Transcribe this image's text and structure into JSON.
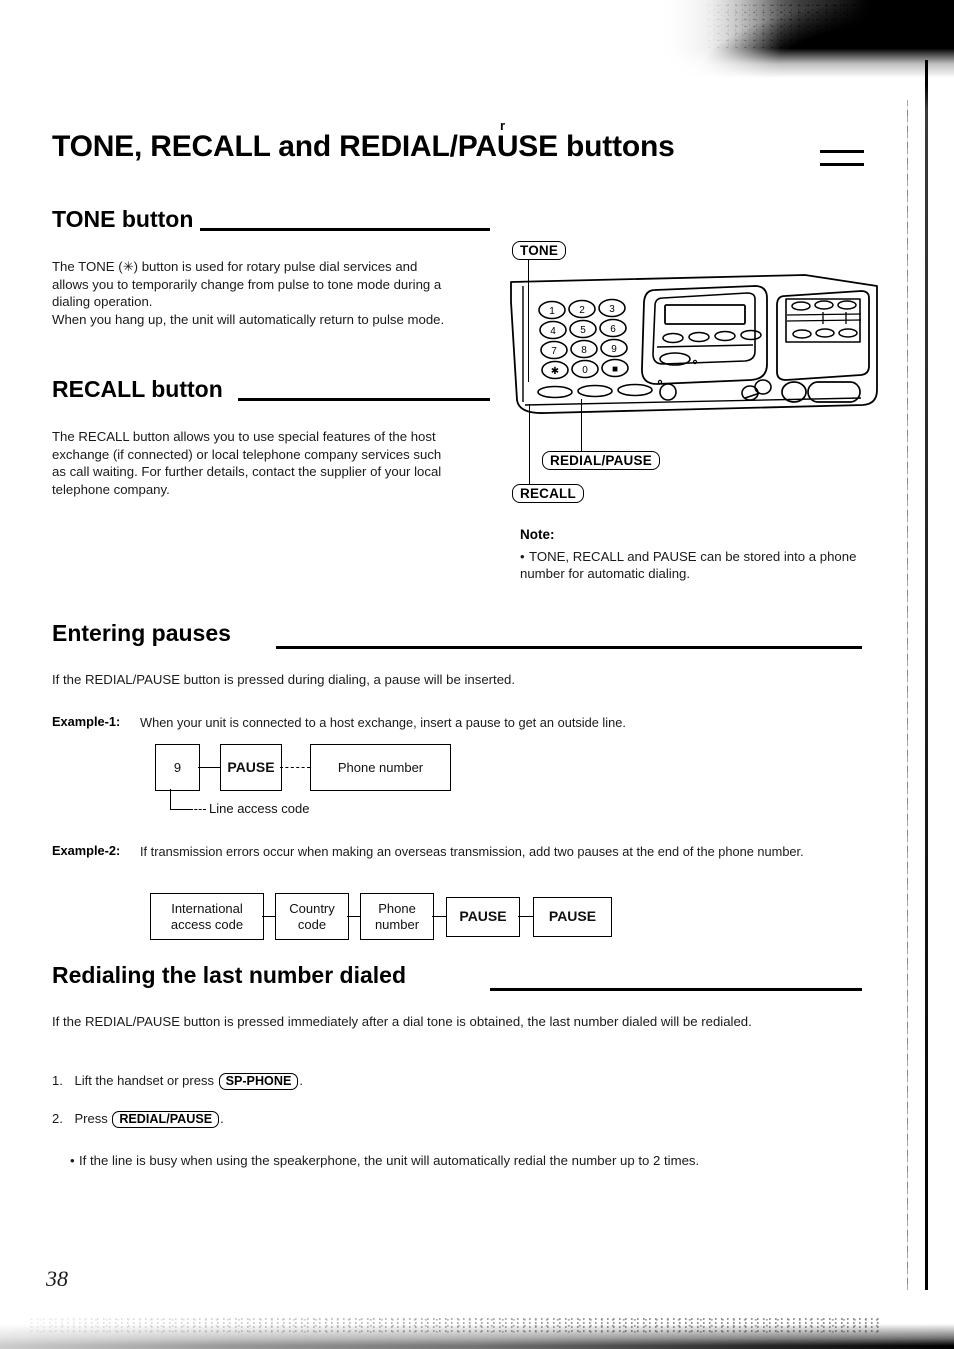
{
  "page": {
    "number": "38",
    "title": "TONE, RECALL and REDIAL/PAUSE buttons",
    "stray_mark": "r"
  },
  "sections": {
    "tone": {
      "heading": "TONE button",
      "body": "The TONE (✳) button is used for rotary pulse dial services and allows you to temporarily change from pulse to tone mode during a dialing operation.\nWhen you hang up, the unit will automatically return to pulse mode."
    },
    "recall": {
      "heading": "RECALL button",
      "body": "The RECALL button allows you to use special features of the host exchange (if connected) or local telephone company services such as call waiting. For further details, contact the supplier of your local telephone company."
    },
    "entering_pauses": {
      "heading": "Entering pauses",
      "intro": "If the REDIAL/PAUSE button is pressed during dialing, a pause will be inserted.",
      "example1": {
        "label": "Example-1:",
        "text": "When your unit is connected to a host exchange, insert a pause to get an outside line.",
        "flow": [
          "9",
          "PAUSE",
          "Phone number"
        ],
        "leader_label": "Line access code"
      },
      "example2": {
        "label": "Example-2:",
        "text": "If transmission errors occur when making an overseas transmission, add two pauses at the end of the phone number.",
        "flow": [
          "International access code",
          "Country code",
          "Phone number",
          "PAUSE",
          "PAUSE"
        ]
      }
    },
    "redialing": {
      "heading": "Redialing the last number dialed",
      "intro": "If the REDIAL/PAUSE button is pressed immediately after a dial tone is obtained, the last number dialed will be redialed.",
      "steps": [
        {
          "num": "1.",
          "before": "Lift the handset or press ",
          "key": "SP-PHONE",
          "after": "."
        },
        {
          "num": "2.",
          "before": "Press ",
          "key": "REDIAL/PAUSE",
          "after": "."
        }
      ],
      "note": "If the line is busy when using the speakerphone, the unit will automatically redial the number up to 2 times."
    }
  },
  "note_block": {
    "title": "Note:",
    "text": "TONE, RECALL and PAUSE can be stored into a phone number for automatic dialing."
  },
  "diagram": {
    "name": "fax-machine-control-panel",
    "callouts": [
      {
        "id": "tone",
        "label": "TONE"
      },
      {
        "id": "redial-pause",
        "label": "REDIAL/PAUSE"
      },
      {
        "id": "recall",
        "label": "RECALL"
      }
    ],
    "keypad": [
      [
        "1",
        "2",
        "3"
      ],
      [
        "4",
        "5",
        "6"
      ],
      [
        "7",
        "8",
        "9"
      ],
      [
        "✳",
        "0",
        "■"
      ]
    ]
  }
}
